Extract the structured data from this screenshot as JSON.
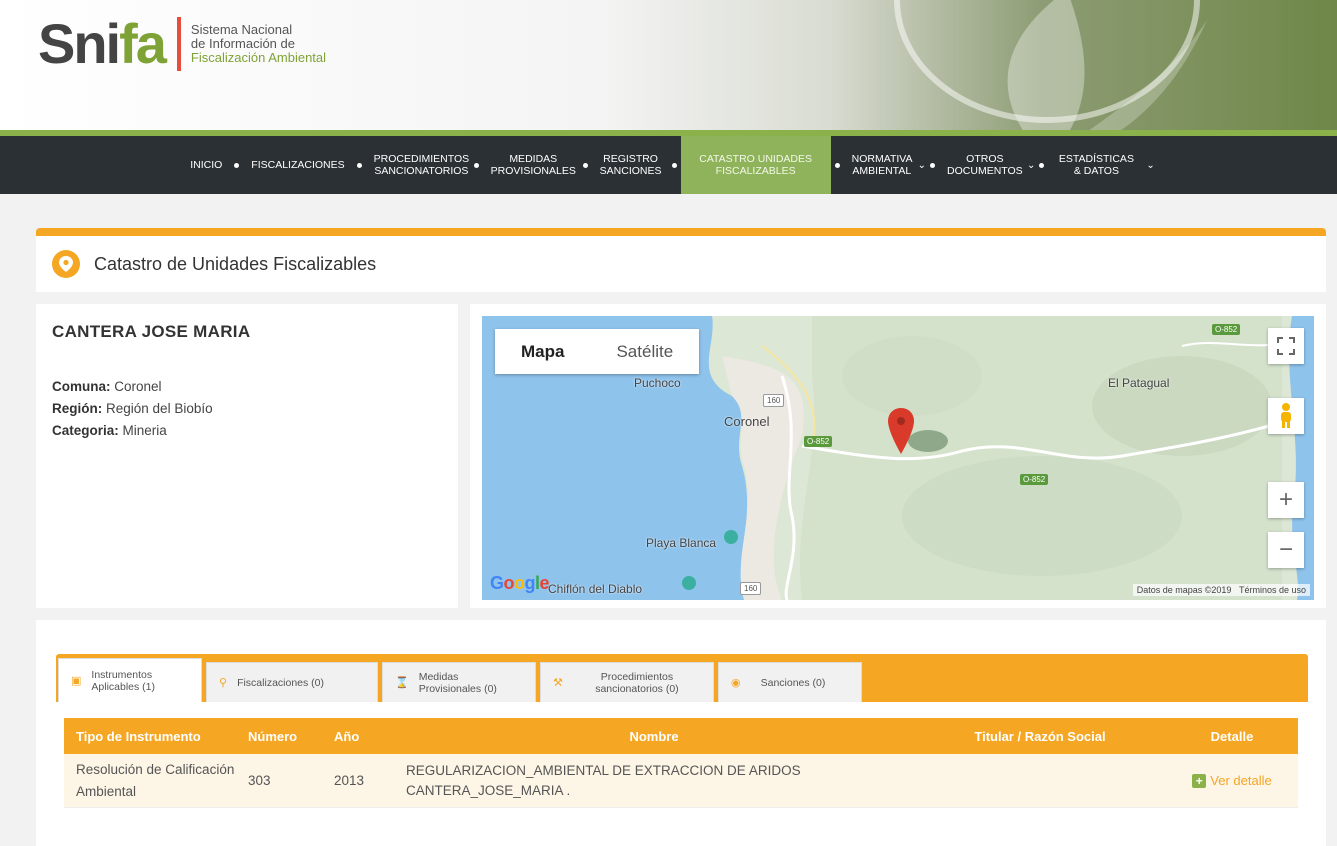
{
  "header": {
    "logo_main": "Sni",
    "logo_accent": "fa",
    "logo_line1": "Sistema Nacional",
    "logo_line2": "de Información de",
    "logo_line3": "Fiscalización Ambiental"
  },
  "nav": {
    "items": [
      {
        "label": "INICIO",
        "active": false
      },
      {
        "label": "FISCALIZACIONES",
        "active": false
      },
      {
        "label": "PROCEDIMIENTOS SANCIONATORIOS",
        "active": false
      },
      {
        "label": "MEDIDAS PROVISIONALES",
        "active": false
      },
      {
        "label": "REGISTRO SANCIONES",
        "active": false
      },
      {
        "label": "CATASTRO UNIDADES FISCALIZABLES",
        "active": true
      },
      {
        "label": "NORMATIVA AMBIENTAL",
        "active": false
      },
      {
        "label": "OTROS DOCUMENTOS",
        "active": false
      },
      {
        "label": "ESTADÍSTICAS & DATOS",
        "active": false
      }
    ]
  },
  "section": {
    "title": "Catastro de Unidades Fiscalizables"
  },
  "unit": {
    "name": "CANTERA JOSE MARIA",
    "comuna_label": "Comuna:",
    "comuna_value": "Coronel",
    "region_label": "Región:",
    "region_value": "Región del Biobío",
    "categoria_label": "Categoria:",
    "categoria_value": "Mineria"
  },
  "map": {
    "type_map": "Mapa",
    "type_satellite": "Satélite",
    "places": {
      "puchoco": "Puchoco",
      "coronel": "Coronel",
      "el_patagual": "El Patagual",
      "playa_blanca": "Playa Blanca",
      "chiflon": "Chiflón del Diablo"
    },
    "roads": {
      "r160a": "160",
      "r160b": "160",
      "o852a": "O-852",
      "o852b": "O-852",
      "o852c": "O-852"
    },
    "google": "Google",
    "footer_data": "Datos de mapas ©2019",
    "footer_terms": "Términos de uso",
    "zoom_in": "+",
    "zoom_out": "−"
  },
  "tabs": [
    {
      "label": "Instrumentos Aplicables (1)",
      "icon": "document-icon"
    },
    {
      "label": "Fiscalizaciones (0)",
      "icon": "search-icon"
    },
    {
      "label": "Medidas Provisionales (0)",
      "icon": "hourglass-icon"
    },
    {
      "label": "Procedimientos sancionatorios (0)",
      "icon": "gavel-icon"
    },
    {
      "label": "Sanciones (0)",
      "icon": "eye-icon"
    }
  ],
  "table": {
    "headers": {
      "tipo": "Tipo de Instrumento",
      "numero": "Número",
      "anio": "Año",
      "nombre": "Nombre",
      "titular": "Titular / Razón Social",
      "detalle": "Detalle"
    },
    "rows": [
      {
        "tipo": "Resolución de Calificación Ambiental",
        "numero": "303",
        "anio": "2013",
        "nombre": "REGULARIZACION_AMBIENTAL DE EXTRACCION DE ARIDOS CANTERA_JOSE_MARIA .",
        "titular": "",
        "detalle": "Ver detalle"
      }
    ]
  },
  "colors": {
    "accent_orange": "#f5a623",
    "accent_green": "#8bb24a",
    "nav_bg": "#2b3035"
  }
}
